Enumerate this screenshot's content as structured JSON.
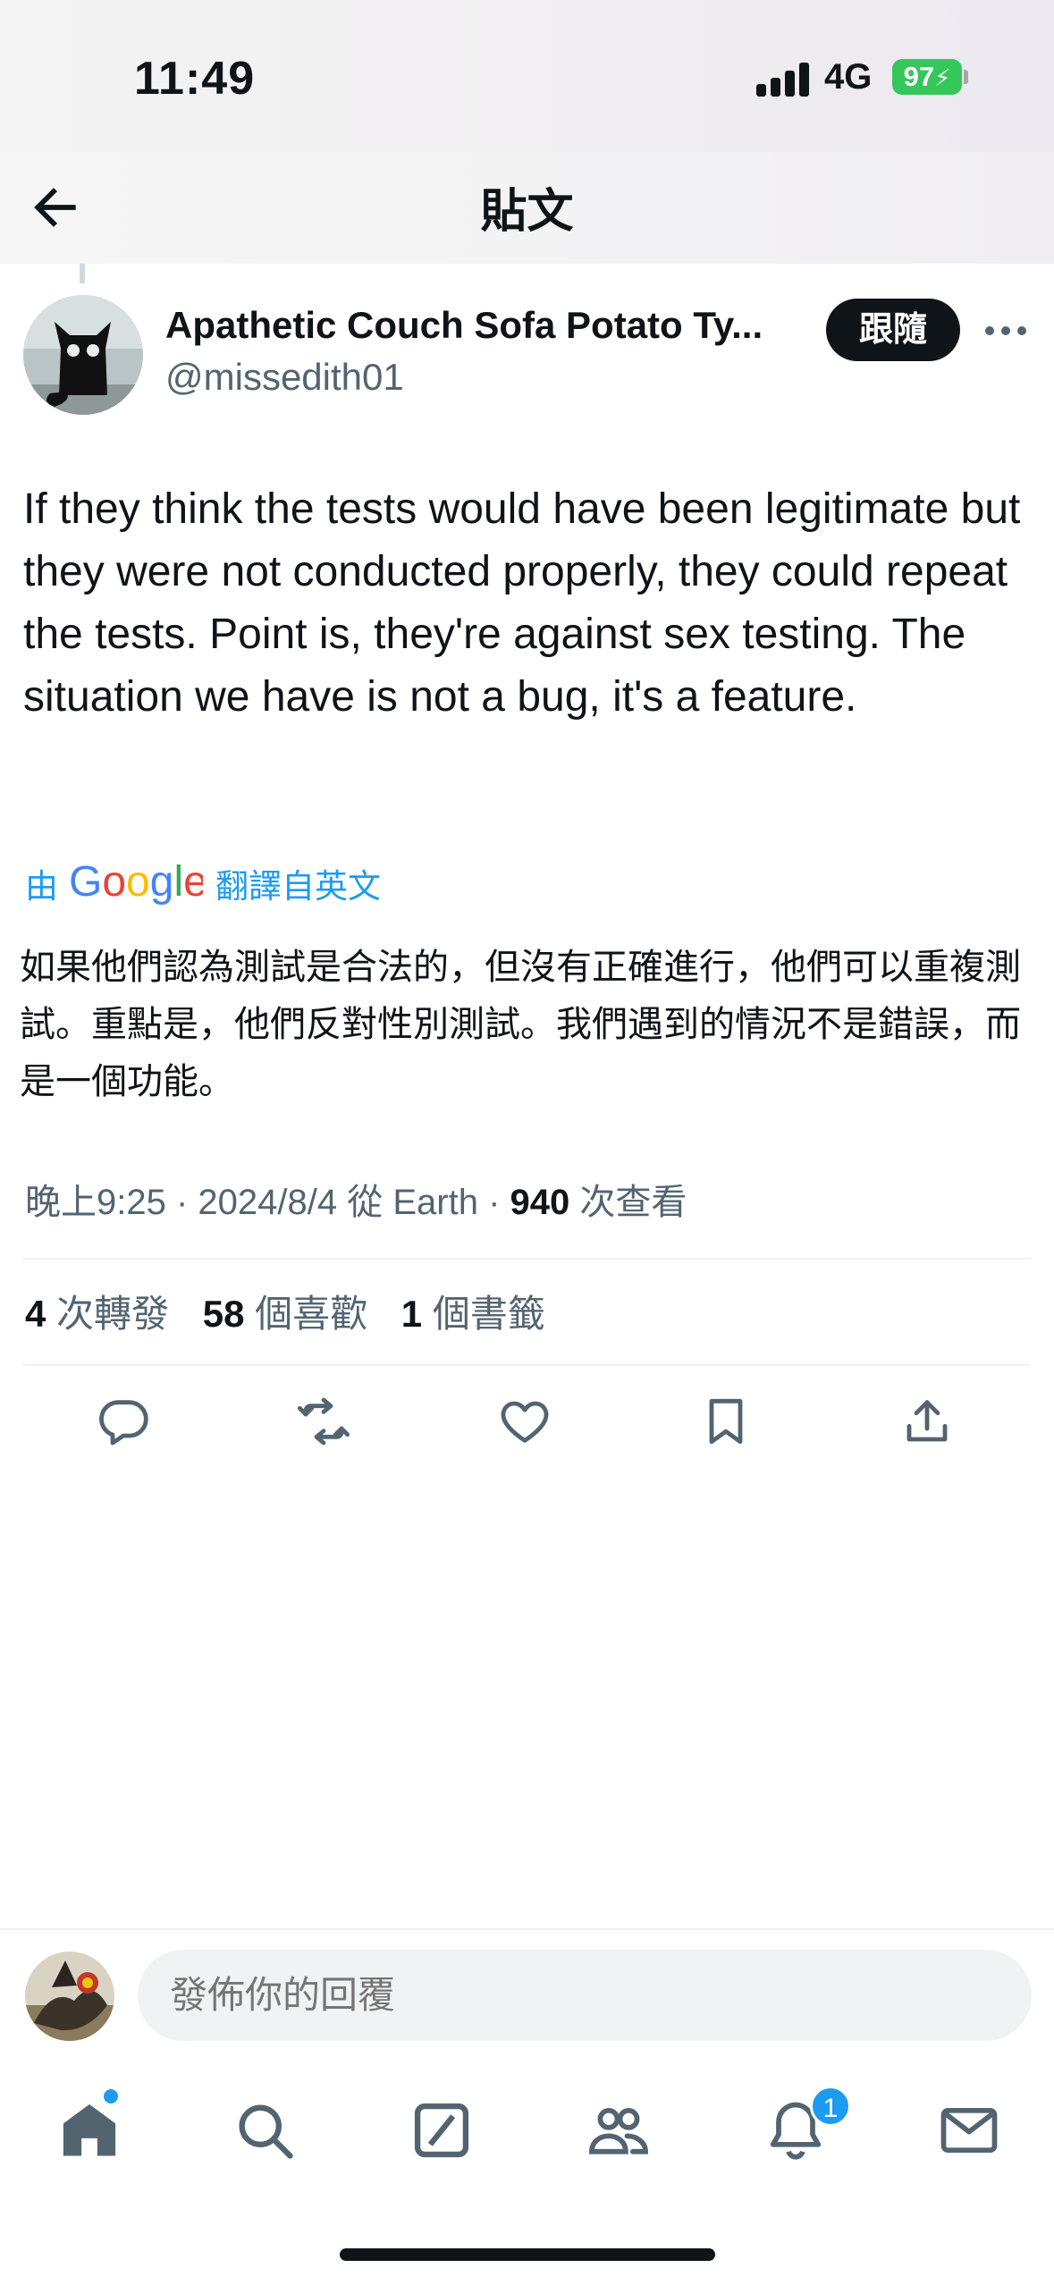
{
  "status_bar": {
    "time": "11:49",
    "network": "4G",
    "battery": "97"
  },
  "header": {
    "title": "貼文",
    "back_icon": "arrow-left-icon"
  },
  "author": {
    "display_name": "Apathetic Couch Sofa Potato Ty...",
    "handle": "@missedith01",
    "follow_label": "跟隨",
    "more_icon": "more-dots-icon"
  },
  "tweet": {
    "text": "If they think the tests would have been legitimate but they were not conducted properly, they could repeat the tests. Point is, they're against sex testing. The situation we have is not a bug, it's a feature.",
    "translation_prefix": "由",
    "translation_provider": "Google",
    "translation_suffix": "翻譯自英文",
    "translated_text": "如果他們認為測試是合法的，但沒有正確進行，他們可以重複測試。重點是，他們反對性別測試。我們遇到的情況不是錯誤，而是一個功能。"
  },
  "meta": {
    "time": "晚上9:25",
    "date": "2024/8/4",
    "source": "從 Earth",
    "views_count": "940",
    "views_label": "次查看"
  },
  "stats": {
    "retweets_count": "4",
    "retweets_label": "次轉發",
    "likes_count": "58",
    "likes_label": "個喜歡",
    "bookmarks_count": "1",
    "bookmarks_label": "個書籤"
  },
  "actions": [
    "reply-icon",
    "retweet-icon",
    "like-icon",
    "bookmark-icon",
    "share-icon"
  ],
  "reply": {
    "placeholder": "發佈你的回覆"
  },
  "tabbar": {
    "items": [
      "home-icon",
      "search-icon",
      "grok-icon",
      "communities-icon",
      "notifications-icon",
      "messages-icon"
    ],
    "notification_badge": "1"
  },
  "colors": {
    "accent": "#1d9bf0",
    "text": "#0f1419",
    "secondary": "#536471",
    "battery": "#34c759"
  }
}
